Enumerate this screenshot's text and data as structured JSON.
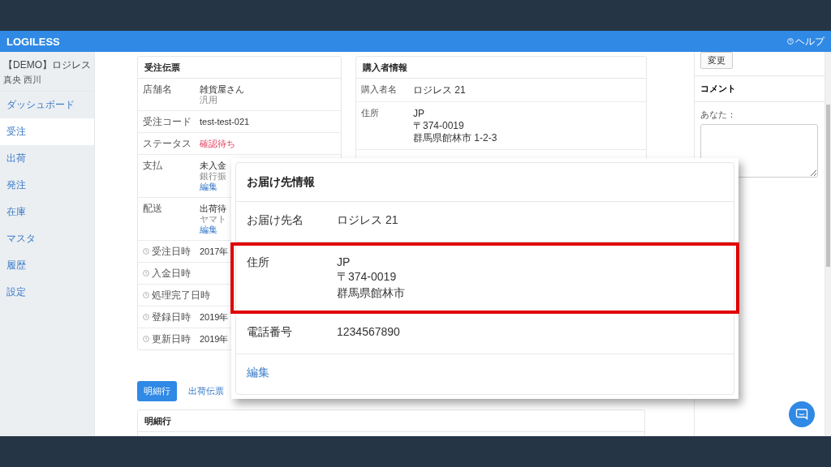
{
  "header": {
    "logo": "LOGILESS",
    "help": "ヘルプ"
  },
  "sidebar": {
    "account": "【DEMO】ロジレス",
    "user": "真央 西川",
    "items": [
      {
        "label": "ダッシュボード",
        "selected": false
      },
      {
        "label": "受注",
        "selected": true
      },
      {
        "label": "出荷",
        "selected": false
      },
      {
        "label": "発注",
        "selected": false
      },
      {
        "label": "在庫",
        "selected": false
      },
      {
        "label": "マスタ",
        "selected": false
      },
      {
        "label": "履歴",
        "selected": false
      },
      {
        "label": "設定",
        "selected": false
      }
    ]
  },
  "order_card": {
    "title": "受注伝票",
    "rows": [
      {
        "label": "店舗名",
        "kind": "plain",
        "lines": [
          "雑貨屋さん",
          "汎用"
        ]
      },
      {
        "label": "受注コード",
        "kind": "plain",
        "lines": [
          "test-test-021"
        ]
      },
      {
        "label": "ステータス",
        "kind": "status",
        "lines": [
          "確認待ち"
        ]
      },
      {
        "label": "支払",
        "kind": "plain",
        "lines": [
          "未入金",
          "銀行振"
        ],
        "link": "編集"
      },
      {
        "label": "配送",
        "kind": "plain",
        "lines": [
          "出荷待",
          "ヤマト"
        ],
        "link": "編集"
      },
      {
        "label": "受注日時",
        "kind": "time",
        "lines": [
          "2017年"
        ]
      },
      {
        "label": "入金日時",
        "kind": "time",
        "lines": []
      },
      {
        "label": "処理完了日時",
        "kind": "time",
        "lines": []
      },
      {
        "label": "登録日時",
        "kind": "time",
        "lines": [
          "2019年"
        ]
      },
      {
        "label": "更新日時",
        "kind": "time",
        "lines": [
          "2019年"
        ]
      }
    ]
  },
  "buyer_card": {
    "title": "購入者情報",
    "rows": [
      {
        "label": "購入者名",
        "lines": [
          "ロジレス 21"
        ]
      },
      {
        "label": "住所",
        "lines": [
          "JP",
          "〒374-0019",
          "群馬県館林市 1-2-3"
        ]
      }
    ]
  },
  "detail_tabs": [
    {
      "label": "明細行",
      "selected": true
    },
    {
      "label": "出荷伝票",
      "selected": false
    }
  ],
  "detail_card": {
    "title": "明細行"
  },
  "side_panel": {
    "change_button": "変更",
    "comment_title": "コメント",
    "comment_label": "あなた："
  },
  "callout": {
    "title": "お届け先情報",
    "rows": [
      {
        "label": "お届け先名",
        "lines": [
          "ロジレス 21"
        ],
        "highlighted": false
      },
      {
        "label": "住所",
        "lines": [
          "JP",
          "〒374-0019",
          "群馬県館林市"
        ],
        "highlighted": true
      },
      {
        "label": "電話番号",
        "lines": [
          "1234567890"
        ],
        "highlighted": false
      }
    ],
    "edit_link": "編集"
  }
}
